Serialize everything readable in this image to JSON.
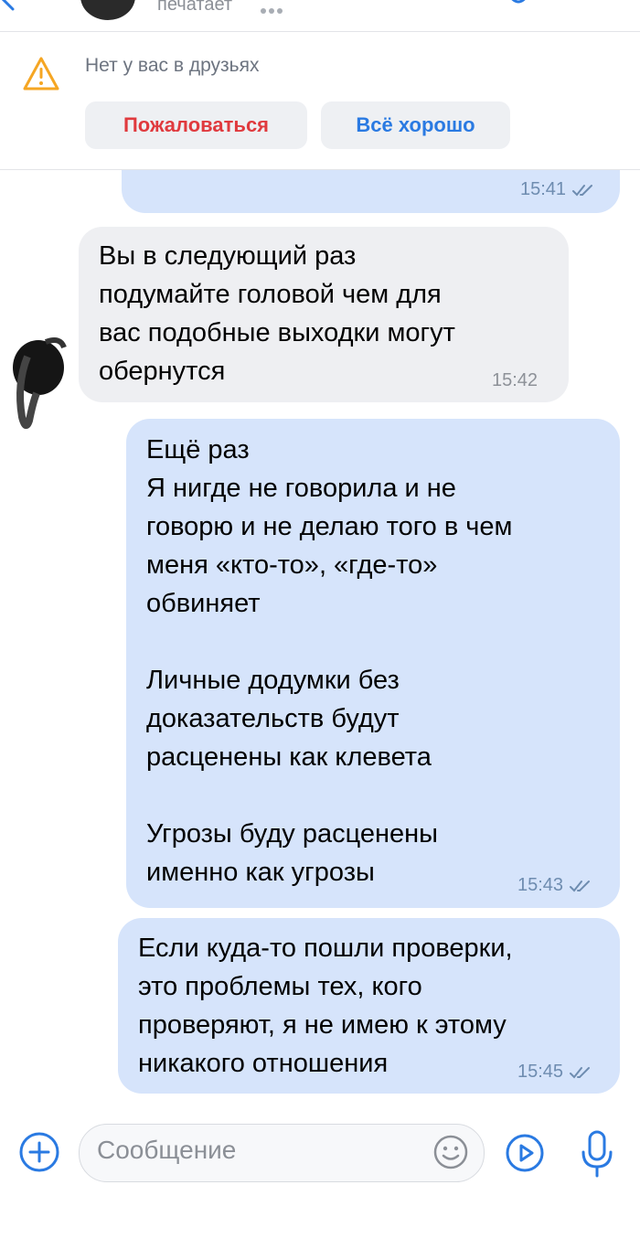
{
  "header": {
    "status": "печатает"
  },
  "warning": {
    "text": "Нет у вас в друзьях",
    "report_label": "Пожаловаться",
    "ok_label": "Всё хорошо"
  },
  "messages": [
    {
      "direction": "out",
      "text": "",
      "time": "15:41"
    },
    {
      "direction": "in",
      "text": "Вы в следующий раз\nподумайте головой чем для\nвас подобные выходки могут\nобернутся",
      "time": "15:42"
    },
    {
      "direction": "out",
      "text": "Ещё раз\nЯ нигде не говорила и не\nговорю и не делаю того в чем\nменя «кто-то», «где-то»\nобвиняет\n\nЛичные додумки без\nдоказательств будут\nрасценены как клевета\n\nУгрозы буду расценены\nименно как угрозы",
      "time": "15:43"
    },
    {
      "direction": "out",
      "text": "Если куда-то пошли проверки,\nэто проблемы тех, кого\nпроверяют, я не имею к этому\nникакого отношения",
      "time": "15:45"
    }
  ],
  "composer": {
    "placeholder": "Сообщение"
  },
  "icons": {
    "warning": "warning-triangle-icon",
    "read": "double-check-icon",
    "attach": "plus-circle-icon",
    "emoji": "smile-icon",
    "video": "play-circle-icon",
    "voice": "microphone-icon"
  },
  "colors": {
    "accent": "#2a7ae2",
    "danger": "#e03a3e",
    "warning": "#f5a623",
    "outgoing_bubble": "#d6e4fb",
    "incoming_bubble": "#eeeff2"
  }
}
